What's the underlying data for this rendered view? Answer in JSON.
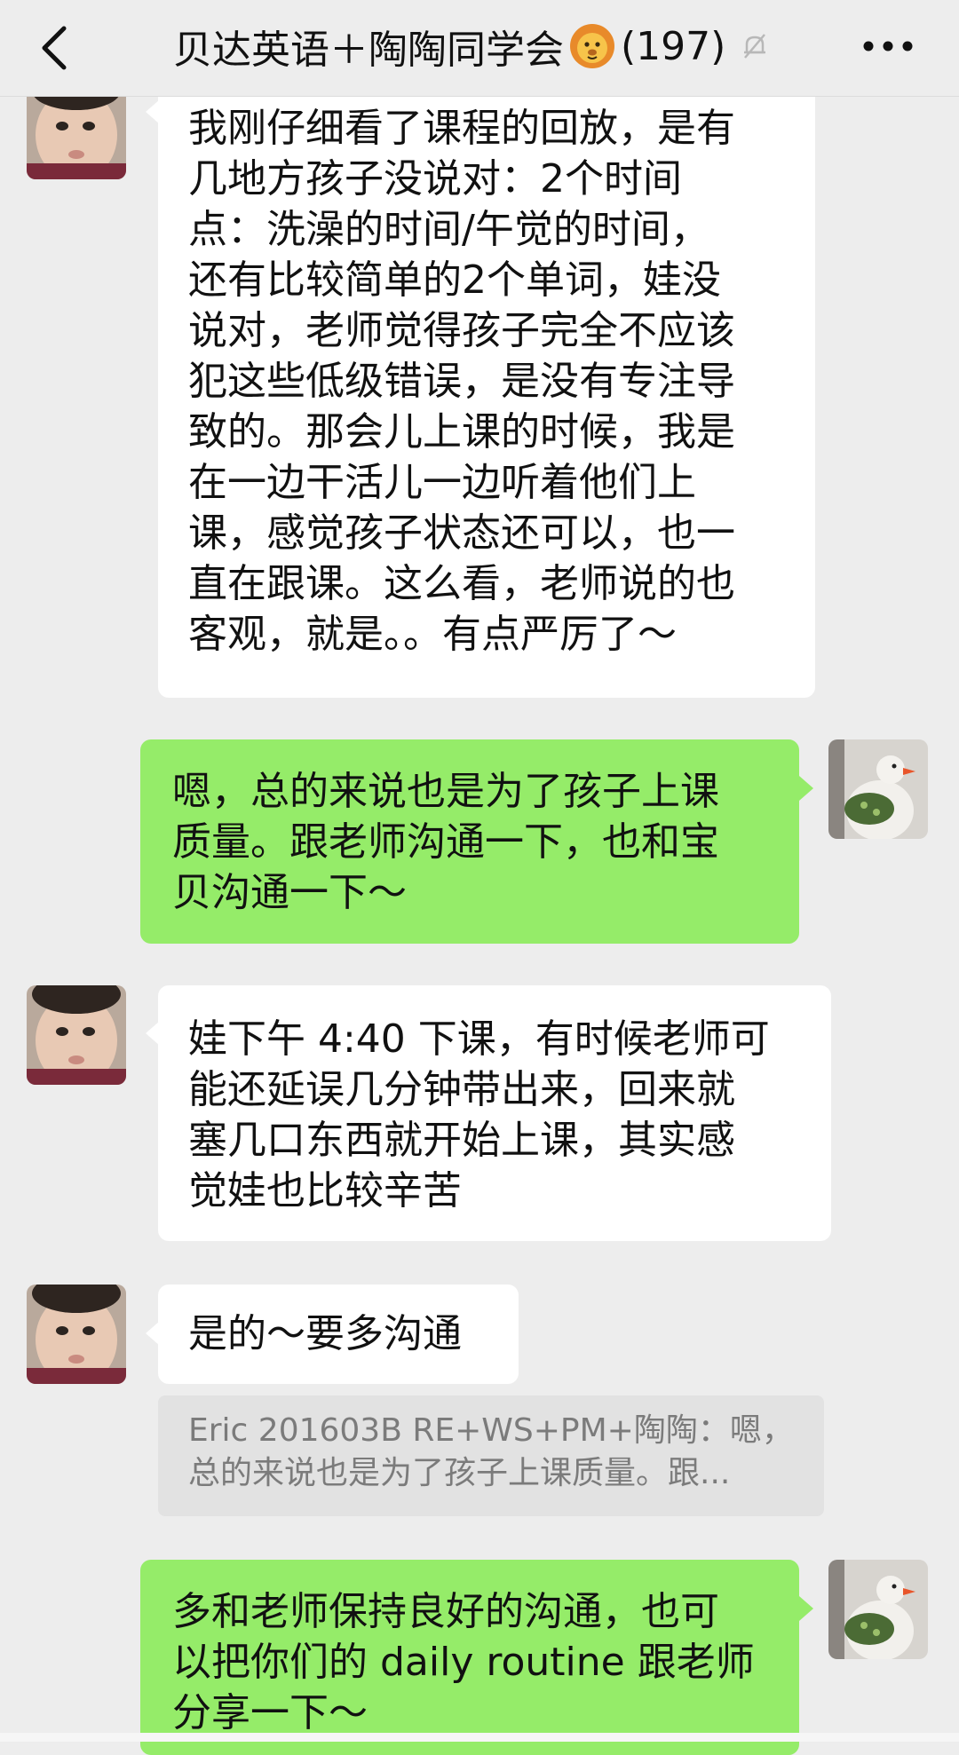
{
  "header": {
    "title": "贝达英语＋陶陶同学会",
    "member_count": "(197)"
  },
  "icons": {
    "back": "back-chevron-icon",
    "lion": "lion-emoji-icon",
    "mute": "mute-bell-icon",
    "more": "more-dots-icon"
  },
  "colors": {
    "outgoing_bubble": "#95ec69",
    "incoming_bubble": "#ffffff",
    "background": "#ededed",
    "quote_bg": "#e2e2e2"
  },
  "messages": [
    {
      "direction": "in",
      "lines": [
        "我刚仔细看了课程的回放，是有",
        "几地方孩子没说对：2个时间",
        "点：洗澡的时间/午觉的时间，",
        "还有比较简单的2个单词，娃没",
        "说对，老师觉得孩子完全不应该",
        "犯这些低级错误，是没有专注导",
        "致的。那会儿上课的时候，我是",
        "在一边干活儿一边听着他们上",
        "课，感觉孩子状态还可以，也一",
        "直在跟课。这么看，老师说的也",
        "客观，就是。。有点严厉了～"
      ]
    },
    {
      "direction": "out",
      "lines": [
        "嗯，总的来说也是为了孩子上课",
        "质量。跟老师沟通一下，也和宝",
        "贝沟通一下～"
      ]
    },
    {
      "direction": "in",
      "lines": [
        "娃下午 4:40 下课，有时候老师可",
        "能还延误几分钟带出来，回来就",
        "塞几口东西就开始上课，其实感",
        "觉娃也比较辛苦"
      ]
    },
    {
      "direction": "in",
      "lines": [
        "是的～要多沟通"
      ],
      "quote": [
        "Eric 201603B RE+WS+PM+陶陶：嗯，",
        "总的来说也是为了孩子上课质量。跟..."
      ]
    },
    {
      "direction": "out",
      "lines": [
        "多和老师保持良好的沟通，也可",
        "以把你们的 daily routine 跟老师",
        "分享一下～"
      ]
    }
  ]
}
